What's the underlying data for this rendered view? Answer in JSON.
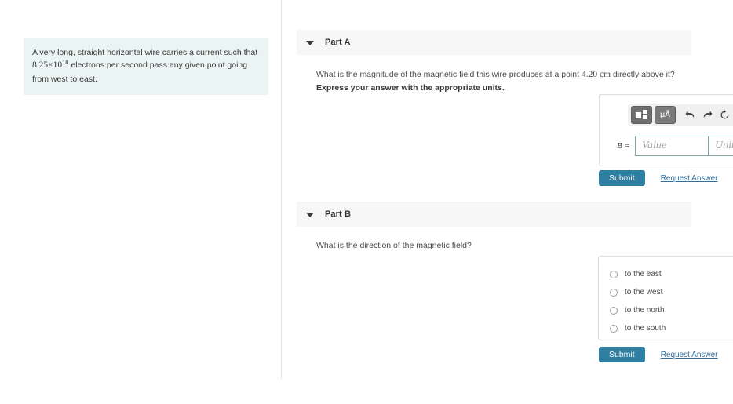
{
  "problem": {
    "text_before": "A very long, straight horizontal wire carries a current such that ",
    "coefficient": "8.25×10",
    "exponent": "18",
    "text_after": " electrons per second pass any given point going from west to east."
  },
  "parts": [
    {
      "header": "Part A",
      "caret_icon": "chevron-down-icon",
      "question_before": "What is the magnitude of the magnetic field this wire produces at a point ",
      "question_value": "4.20",
      "question_unit": "cm",
      "question_after": " directly above it?",
      "instruction": "Express your answer with the appropriate units.",
      "answer_label": "B =",
      "value_placeholder": "Value",
      "units_placeholder": "Units",
      "value_current": "",
      "units_current": "",
      "toolbar": {
        "templates_icon": "math-templates-icon",
        "units_label": "μA",
        "units_superscript": "̊",
        "undo_icon": "undo-icon",
        "redo_icon": "redo-icon",
        "reset_icon": "reset-icon",
        "keyboard_icon": "keyboard-icon",
        "help_label": "?"
      },
      "submit_label": "Submit",
      "request_label": "Request Answer"
    },
    {
      "header": "Part B",
      "caret_icon": "chevron-down-icon",
      "question": "What is the direction of the magnetic field?",
      "choices": [
        "to the east",
        "to the west",
        "to the north",
        "to the south"
      ],
      "selected": null,
      "submit_label": "Submit",
      "request_label": "Request Answer"
    }
  ],
  "colors": {
    "problem_box_bg": "#eaf4f3",
    "part_header_bg": "#f7f7f7",
    "submit_bg": "#2e7fa1",
    "link": "#2e6e9e",
    "input_border": "#7fa8a6"
  }
}
